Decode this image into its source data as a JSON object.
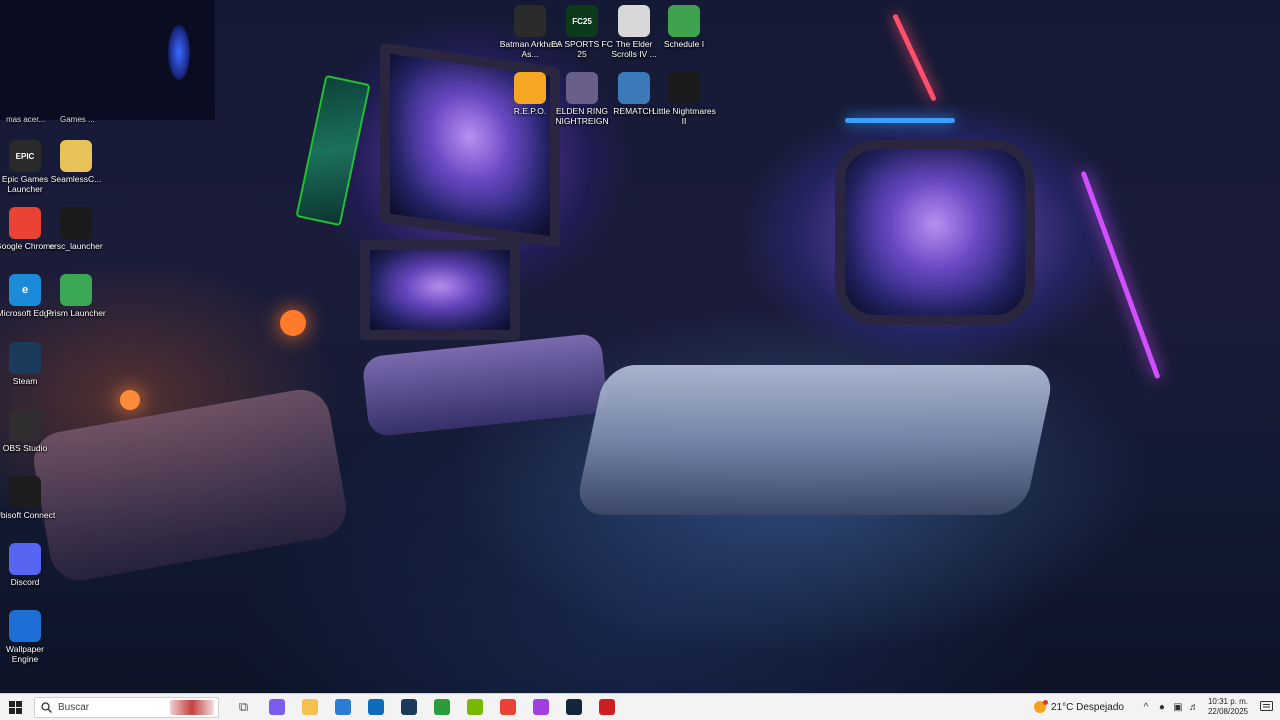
{
  "desktop": {
    "partial_labels": [
      "mas acer...",
      "Games ..."
    ],
    "left_column": [
      {
        "id": "epic",
        "label": "Epic Games Launcher",
        "icon": "epic-games-icon",
        "glyph": "EPIC",
        "color": "#2a2a2a"
      },
      {
        "id": "chrome",
        "label": "Google Chrome",
        "icon": "chrome-icon",
        "glyph": "",
        "color": "#ea4335"
      },
      {
        "id": "edge",
        "label": "Microsoft Edge",
        "icon": "edge-icon",
        "glyph": "e",
        "color": "#1b8ad8"
      },
      {
        "id": "steam",
        "label": "Steam",
        "icon": "steam-icon",
        "glyph": "",
        "color": "#1b3a5c"
      },
      {
        "id": "obs",
        "label": "OBS Studio",
        "icon": "obs-icon",
        "glyph": "",
        "color": "#302e31"
      },
      {
        "id": "ubisoft",
        "label": "Ubisoft Connect",
        "icon": "ubisoft-icon",
        "glyph": "",
        "color": "#1c1c1c"
      },
      {
        "id": "discord",
        "label": "Discord",
        "icon": "discord-icon",
        "glyph": "",
        "color": "#5865f2"
      },
      {
        "id": "wallpaper",
        "label": "Wallpaper Engine",
        "icon": "wallpaper-engine-icon",
        "glyph": "",
        "color": "#1d6fd6"
      }
    ],
    "second_column": [
      {
        "id": "seamless",
        "label": "SeamlessC...",
        "icon": "folder-icon",
        "glyph": "",
        "color": "#e8c35a"
      },
      {
        "id": "ersc",
        "label": "ersc_launcher",
        "icon": "ersc-launcher-icon",
        "glyph": "",
        "color": "#1a1a1a"
      },
      {
        "id": "prism",
        "label": "Prism Launcher",
        "icon": "prism-launcher-icon",
        "glyph": "",
        "color": "#3aa855"
      }
    ],
    "top_row": [
      {
        "id": "batman",
        "label": "Batman Arkham As...",
        "icon": "batman-icon",
        "glyph": "",
        "color": "#2b2b2b"
      },
      {
        "id": "fc25",
        "label": "EA SPORTS FC 25",
        "icon": "ea-fc25-icon",
        "glyph": "FC25",
        "color": "#0c3a1a"
      },
      {
        "id": "elder",
        "label": "The Elder Scrolls IV ...",
        "icon": "elder-scrolls-icon",
        "glyph": "",
        "color": "#d8d8d8"
      },
      {
        "id": "schedule",
        "label": "Schedule I",
        "icon": "schedule-i-icon",
        "glyph": "",
        "color": "#3fa34d"
      }
    ],
    "second_row": [
      {
        "id": "repo",
        "label": "R.E.P.O.",
        "icon": "repo-icon",
        "glyph": "",
        "color": "#f5a623"
      },
      {
        "id": "eldenring",
        "label": "ELDEN RING NIGHTREIGN",
        "icon": "elden-ring-icon",
        "glyph": "",
        "color": "#6a5f8a"
      },
      {
        "id": "rematch",
        "label": "REMATCH",
        "icon": "rematch-icon",
        "glyph": "",
        "color": "#3a7ab8"
      },
      {
        "id": "little",
        "label": "Little Nightmares II",
        "icon": "little-nightmares-icon",
        "glyph": "",
        "color": "#1a1a1a"
      }
    ]
  },
  "taskbar": {
    "search_placeholder": "Buscar",
    "apps": [
      {
        "name": "task-view-icon",
        "glyph": "⧉",
        "color": "#555"
      },
      {
        "name": "copilot-icon",
        "glyph": "",
        "color": "#7a5cf0"
      },
      {
        "name": "file-explorer-icon",
        "glyph": "",
        "color": "#f2c14e"
      },
      {
        "name": "microsoft-store-icon",
        "glyph": "",
        "color": "#2b7cd3"
      },
      {
        "name": "outlook-icon",
        "glyph": "",
        "color": "#0f6cbd"
      },
      {
        "name": "steam-icon",
        "glyph": "",
        "color": "#1b3a5c"
      },
      {
        "name": "xbox-icon",
        "glyph": "",
        "color": "#2a9d3a"
      },
      {
        "name": "nvidia-icon",
        "glyph": "",
        "color": "#76b900"
      },
      {
        "name": "chrome-icon",
        "glyph": "",
        "color": "#ea4335"
      },
      {
        "name": "messenger-icon",
        "glyph": "",
        "color": "#a03ee0"
      },
      {
        "name": "steam-icon",
        "glyph": "",
        "color": "#13253a"
      },
      {
        "name": "game-app-icon",
        "glyph": "",
        "color": "#cc2020"
      }
    ],
    "weather": {
      "temp": "21°C",
      "condition": "Despejado"
    },
    "clock": {
      "time": "10:31 p. m.",
      "date": "22/08/2025"
    }
  }
}
